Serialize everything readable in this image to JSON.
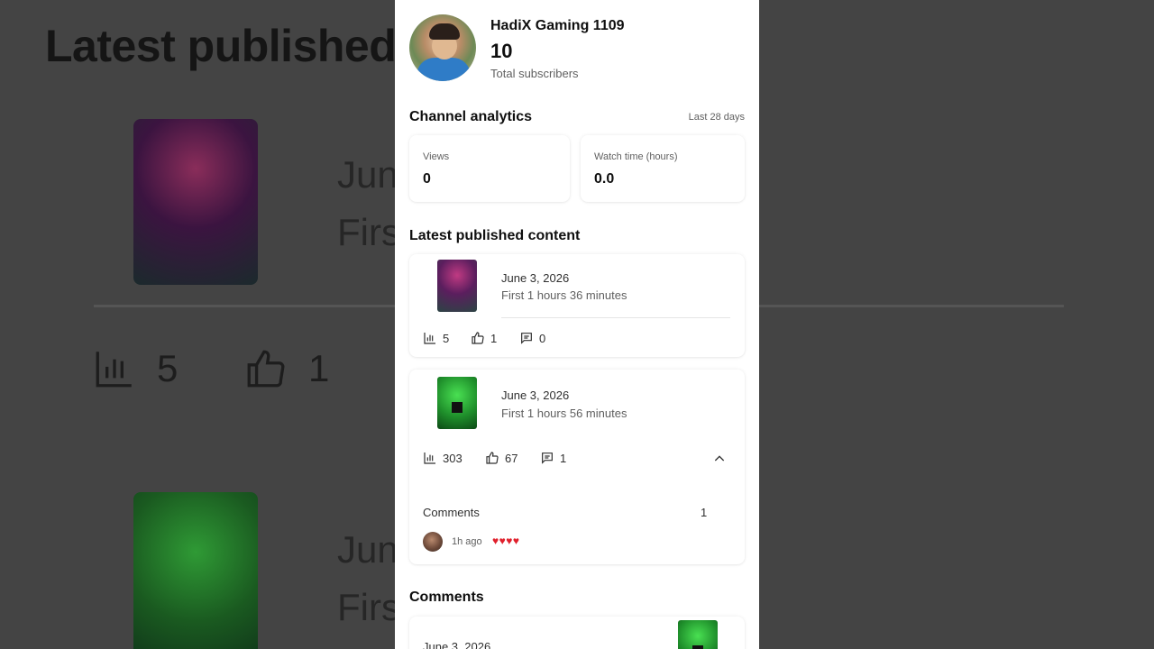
{
  "background": {
    "title": "Latest published",
    "item1_date": "Jun",
    "item1_sub": "Firs",
    "item2_date": "Jun",
    "item2_sub": "Firs",
    "views": "5",
    "likes": "1"
  },
  "channel": {
    "name": "HadiX Gaming 1109",
    "subscribers": "10",
    "subscribers_label": "Total subscribers"
  },
  "analytics": {
    "title": "Channel analytics",
    "period": "Last 28 days",
    "views_label": "Views",
    "views_value": "0",
    "watch_label": "Watch time (hours)",
    "watch_value": "0.0"
  },
  "latest": {
    "title": "Latest published content",
    "items": [
      {
        "date": "June 3, 2026",
        "subtitle": "First 1 hours 36 minutes",
        "views": "5",
        "likes": "1",
        "comments": "0",
        "thumb": "pink"
      },
      {
        "date": "June 3, 2026",
        "subtitle": "First 1 hours 56 minutes",
        "views": "303",
        "likes": "67",
        "comments": "1",
        "thumb": "green",
        "comments_section": {
          "label": "Comments",
          "count": "1",
          "comment_time": "1h ago",
          "comment_text": "♥♥♥♥"
        }
      }
    ]
  },
  "comments_section": {
    "title": "Comments",
    "first_date": "June 3, 2026"
  },
  "icons": {
    "chart": "bar-chart-icon",
    "like": "thumb-up-icon",
    "comment": "comment-icon",
    "collapse": "chevron-up-icon"
  },
  "colors": {
    "heart": "#e0202c",
    "overlay": "#444444"
  }
}
